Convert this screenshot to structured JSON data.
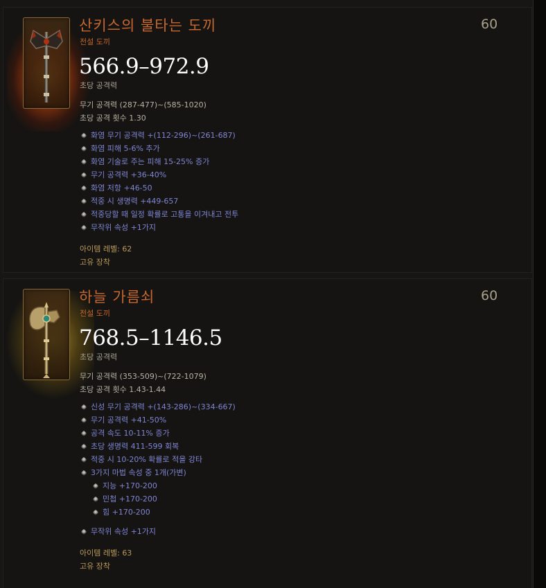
{
  "items": [
    {
      "name": "산키스의 불타는 도끼",
      "type": "전설 도끼",
      "required_level": "60",
      "dps": "566.9–972.9",
      "dps_label": "초당 공격력",
      "damage_label": "무기 공격력",
      "damage_value": "(287-477)~(585-1020)",
      "speed_label": "초당 공격 횟수",
      "speed_value": "1.30",
      "affixes": [
        "화염 무기 공격력 +(112-296)~(261-687)",
        "화염 피해 5-6% 추가",
        "화염 기술로 주는 피해 15-25% 증가",
        "무기 공격력 +36-40%",
        "화염 저항 +46-50",
        "적중 시 생명력 +449-657",
        "적중당할 때 일정 확률로 고통을 이겨내고 전투",
        "무작위 속성 +1가지"
      ],
      "item_level_label": "아이템 레벨:",
      "item_level": "62",
      "bind": "고유 장착",
      "icon": "axe-icon",
      "glow_color": "#e06a18"
    },
    {
      "name": "하늘 가름쇠",
      "type": "전설 도끼",
      "required_level": "60",
      "dps": "768.5–1146.5",
      "dps_label": "초당 공격력",
      "damage_label": "무기 공격력",
      "damage_value": "(353-509)~(722-1079)",
      "speed_label": "초당 공격 횟수",
      "speed_value": "1.43-1.44",
      "affixes": [
        "신성 무기 공격력 +(143-286)~(334-667)",
        "무기 공격력 +41-50%",
        "공격 속도 10-11% 증가",
        "초당 생명력 411-599 회복",
        "적중 시 10-20% 확률로 적을 강타",
        "3가지 마법 속성 중 1개(가변)"
      ],
      "sub_affixes": [
        "지능 +170-200",
        "민첩 +170-200",
        "힘 +170-200"
      ],
      "extra_affix": "무작위 속성 +1가지",
      "item_level_label": "아이템 레벨:",
      "item_level": "63",
      "bind": "고유 장착",
      "icon": "axe-icon",
      "glow_color": "#e8c430"
    }
  ],
  "colors": {
    "name": "#c7682e",
    "affix": "#7f86d4",
    "footer": "#b89a5a",
    "background": "#151412"
  }
}
